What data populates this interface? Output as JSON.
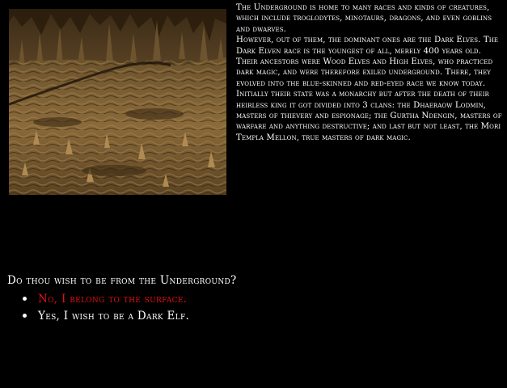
{
  "lore": {
    "paragraph_1": "The Underground is home to many races and kinds of creatures, which include troglodytes, minotaurs, dragons, and even goblins and dwarves.",
    "paragraph_2": "However, out of them, the dominant ones are the Dark Elves. The Dark Elven race is the youngest of all, merely 400 years old. Their ancestors were Wood Elves and High Elves, who practiced dark magic, and were therefore exiled underground. There, they evolved into the blue-skinned and red-eyed race we know today. Initially their state was a monarchy but after the death of their heirless king it got divided into 3 clans: the Dhaeraow Lodmin, masters of thievery and espionage; the Gurtha Ndengin, masters of warfare and anything destructive; and last but not least, the Mori Templa Mellon, true masters of dark magic."
  },
  "prompt": {
    "question": "Do thou wish to be from the Underground?",
    "choices": [
      {
        "label": "No, I belong to the surface.",
        "state": "selected"
      },
      {
        "label": "Yes, I wish to be a Dark Elf.",
        "state": "unselected"
      }
    ]
  },
  "colors": {
    "background": "#000000",
    "text": "#ffffff",
    "highlight": "#e01010"
  },
  "scene": {
    "subject": "underground-cavern-stalagmites"
  }
}
